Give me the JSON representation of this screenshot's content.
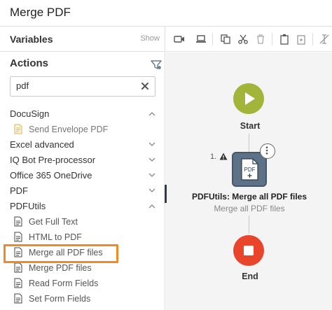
{
  "window": {
    "title": "Merge PDF"
  },
  "variables": {
    "label": "Variables",
    "show_label": "Show"
  },
  "actions": {
    "heading": "Actions",
    "filter_icon": "filter-icon"
  },
  "search": {
    "value": "pdf",
    "clear_icon": "close-icon"
  },
  "categories": {
    "docusign": {
      "name": "DocuSign",
      "expanded": true,
      "items": [
        {
          "label": "Send Envelope PDF"
        }
      ]
    },
    "excel": {
      "name": "Excel advanced",
      "expanded": false
    },
    "iqbot": {
      "name": "IQ Bot Pre-processor",
      "expanded": false
    },
    "onedrive": {
      "name": "Office 365 OneDrive",
      "expanded": false
    },
    "pdf": {
      "name": "PDF",
      "expanded": false
    },
    "pdfutils": {
      "name": "PDFUtils",
      "expanded": true,
      "items": [
        {
          "label": "Get Full Text"
        },
        {
          "label": "HTML to PDF"
        },
        {
          "label": "Merge all PDF files",
          "highlighted": true
        },
        {
          "label": "Merge PDF files"
        },
        {
          "label": "Read Form Fields"
        },
        {
          "label": "Set Form Fields"
        }
      ]
    }
  },
  "toolbar": {
    "icons": [
      "record-icon",
      "laptop-icon",
      "copy-icon",
      "cut-icon",
      "delete-icon",
      "clipboard-icon",
      "paste-icon",
      "disable-icon"
    ]
  },
  "flow": {
    "start": {
      "label": "Start"
    },
    "step": {
      "number": "1.",
      "has_warning": true,
      "title": "PDFUtils: Merge all PDF files",
      "subtitle": "Merge all PDF files",
      "icon_text": "PDF"
    },
    "end": {
      "label": "End"
    }
  },
  "colors": {
    "start": "#a2b43a",
    "end": "#e8452b",
    "node": "#5d7187",
    "highlight": "#f08a24"
  }
}
